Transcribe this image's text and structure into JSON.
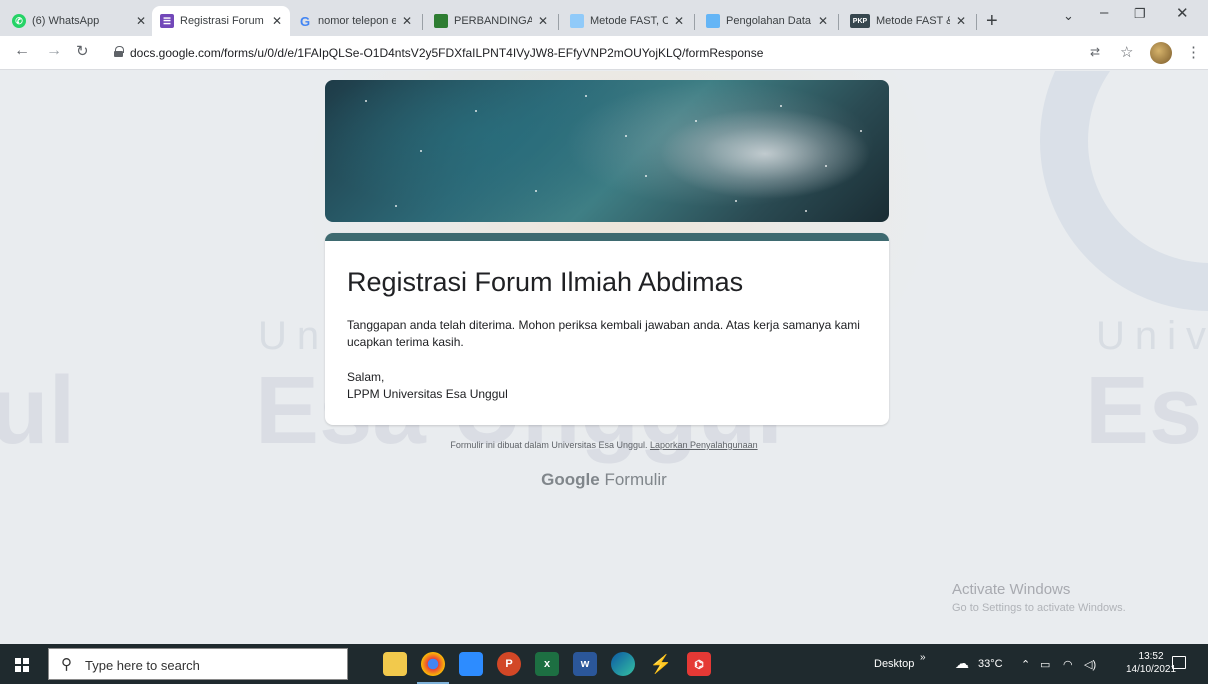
{
  "browser": {
    "tabs": [
      {
        "label": "(6) WhatsApp",
        "favicon": "whatsapp-icon"
      },
      {
        "label": "Registrasi Forum",
        "favicon": "google-forms-icon",
        "active": true
      },
      {
        "label": "nomor telepon e",
        "favicon": "google-icon"
      },
      {
        "label": "PERBANDINGAN",
        "favicon": "document-icon"
      },
      {
        "label": "Metode FAST, Ca",
        "favicon": "website-icon"
      },
      {
        "label": "Pengolahan Data",
        "favicon": "website-icon"
      },
      {
        "label": "Metode FAST & F",
        "favicon": "pkp-icon"
      }
    ],
    "favicon_texts": [
      "G",
      "PKP"
    ],
    "url": "docs.google.com/forms/u/0/d/e/1FAIpQLSe-O1D4ntsV2y5FDXfaILPNT4IVyJW8-EFfyVNP2mOUYojKLQ/formResponse"
  },
  "form": {
    "title": "Registrasi Forum Ilmiah Abdimas",
    "message": "Tanggapan anda telah diterima. Mohon periksa kembali jawaban anda. Atas kerja samanya kami ucapkan terima kasih.",
    "greeting": "Salam,",
    "signature": "LPPM Universitas Esa Unggul",
    "accent_color": "#3e6a70"
  },
  "footer": {
    "note": "Formulir ini dibuat dalam Universitas Esa Unggul.",
    "report_link": "Laporkan Penyalahgunaan",
    "brand_google": "Google",
    "brand_product": "Formulir"
  },
  "watermark": {
    "universitas": "Universitas",
    "univ": "Univ",
    "esa_unggul": "Esa Unggul",
    "ul": "ul",
    "es": "Es"
  },
  "windows_notice": {
    "line1": "Activate Windows",
    "line2": "Go to Settings to activate Windows."
  },
  "taskbar": {
    "search_placeholder": "Type here to search",
    "desktop_label": "Desktop",
    "temperature": "33°C",
    "time": "13:52",
    "date": "14/10/2021"
  }
}
